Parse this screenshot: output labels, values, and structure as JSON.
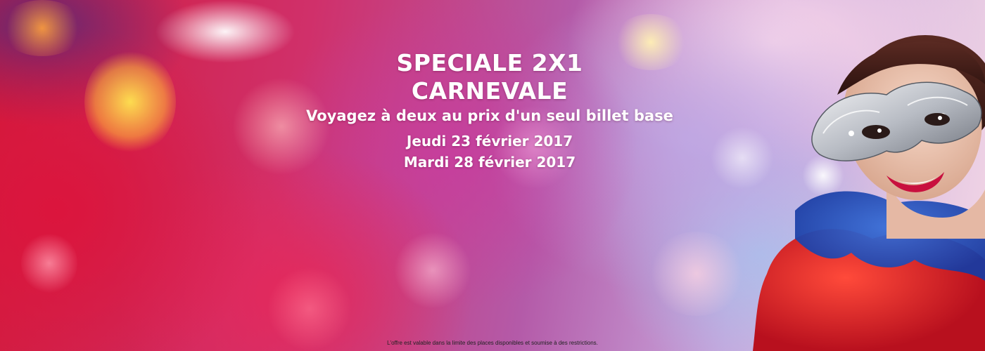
{
  "banner": {
    "title_line1": "SPECIALE 2X1",
    "title_line2": "CARNEVALE",
    "subtitle": "Voyagez à deux au prix d'un seul billet base",
    "dates": [
      "Jeudi 23 février 2017",
      "Mardi 28 février 2017"
    ],
    "disclaimer": "L'offre est valable dans la limite des places disponibles et soumise à des restrictions.",
    "colors": {
      "text": "#ffffff",
      "accent_red": "#d11a3a",
      "accent_pink": "#d0306a",
      "accent_lilac": "#c7a6dc"
    },
    "portrait_icon": "masked-woman-carnival-photo"
  }
}
